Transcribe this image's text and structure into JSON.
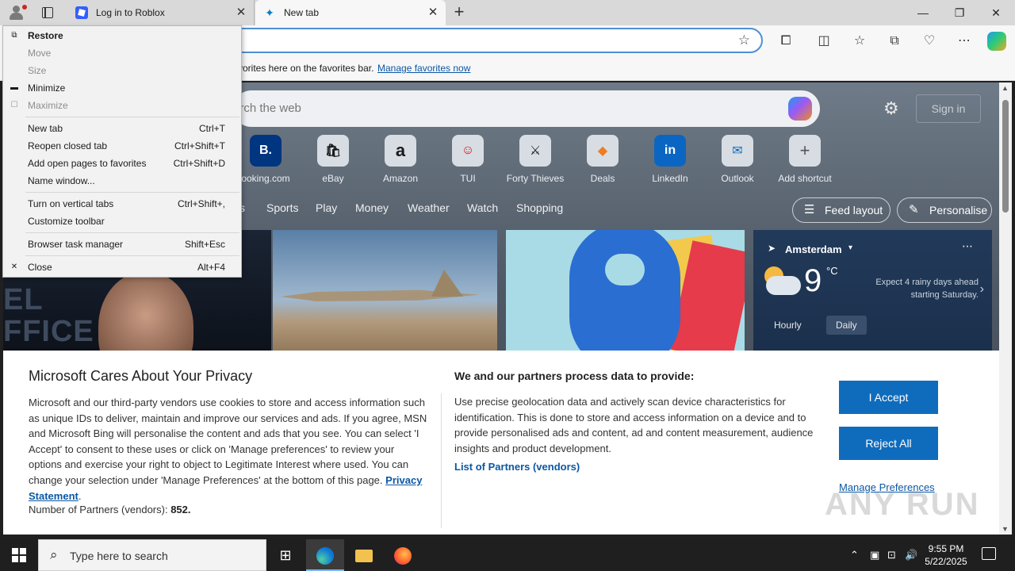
{
  "tabs": [
    {
      "title": "Log in to Roblox"
    },
    {
      "title": "New tab"
    }
  ],
  "window_controls": {
    "minimize": "—",
    "restore": "❐",
    "close": "✕"
  },
  "favorites_bar": {
    "text": "vorites here on the favorites bar.",
    "link": "Manage favorites now"
  },
  "newtab": {
    "search_placeholder": "arch the web",
    "sign_in": "Sign in",
    "shortcuts": [
      {
        "label": "ooking.com",
        "glyph": "B."
      },
      {
        "label": "eBay",
        "glyph": "🛍"
      },
      {
        "label": "Amazon",
        "glyph": "a"
      },
      {
        "label": "TUI",
        "glyph": "☺"
      },
      {
        "label": "Forty Thieves",
        "glyph": "⚔"
      },
      {
        "label": "Deals",
        "glyph": "◆"
      },
      {
        "label": "LinkedIn",
        "glyph": "in"
      },
      {
        "label": "Outlook",
        "glyph": "✉"
      },
      {
        "label": "Add shortcut",
        "glyph": "+"
      }
    ],
    "nav": [
      "s",
      "Sports",
      "Play",
      "Money",
      "Weather",
      "Watch",
      "Shopping"
    ],
    "feed_layout": "Feed layout",
    "personalise": "Personalise",
    "card1_text": "EL\nFFICE",
    "weather": {
      "location": "Amsterdam",
      "temp": "9",
      "unit": "°C",
      "forecast": "Expect 4 rainy days ahead starting Saturday.",
      "tabs": [
        "Hourly",
        "Daily"
      ],
      "active_tab": "Daily"
    }
  },
  "privacy": {
    "title": "Microsoft Cares About Your Privacy",
    "body": "Microsoft and our third-party vendors use cookies to store and access information such as unique IDs to deliver, maintain and improve our services and ads. If you agree, MSN and Microsoft Bing will personalise the content and ads that you see. You can select 'I Accept' to consent to these uses or click on 'Manage preferences' to review your options and exercise your right to object to Legitimate Interest where used.  You can change your selection under 'Manage Preferences' at the bottom of this page.",
    "privacy_link": "Privacy Statement",
    "partners_label": "Number of Partners (vendors):",
    "partners_count": "852.",
    "heading2": "We and our partners process data to provide:",
    "body2": "Use precise geolocation data and actively scan device characteristics for identification. This is done to store and access information on a device and to provide personalised ads and content, ad and content measurement, audience insights and product development.",
    "vendors_link": "List of Partners (vendors)",
    "accept": "I Accept",
    "reject": "Reject All",
    "manage": "Manage Preferences"
  },
  "watermark": "ANY RUN",
  "menu": {
    "items": [
      {
        "label": "Restore",
        "key": "",
        "icon": "restore-icon",
        "glyph": "⧉",
        "disabled": false,
        "bold": true
      },
      {
        "label": "Move",
        "key": "",
        "icon": "",
        "glyph": "",
        "disabled": true,
        "bold": false
      },
      {
        "label": "Size",
        "key": "",
        "icon": "",
        "glyph": "",
        "disabled": true,
        "bold": false
      },
      {
        "label": "Minimize",
        "key": "",
        "icon": "minimize-icon",
        "glyph": "▬",
        "disabled": false,
        "bold": false
      },
      {
        "label": "Maximize",
        "key": "",
        "icon": "maximize-icon",
        "glyph": "☐",
        "disabled": true,
        "bold": false
      },
      {
        "label": "New tab",
        "key": "Ctrl+T",
        "icon": "",
        "glyph": "",
        "disabled": false,
        "bold": false
      },
      {
        "label": "Reopen closed tab",
        "key": "Ctrl+Shift+T",
        "icon": "",
        "glyph": "",
        "disabled": false,
        "bold": false
      },
      {
        "label": "Add open pages to favorites",
        "key": "Ctrl+Shift+D",
        "icon": "",
        "glyph": "",
        "disabled": false,
        "bold": false
      },
      {
        "label": "Name window...",
        "key": "",
        "icon": "",
        "glyph": "",
        "disabled": false,
        "bold": false
      },
      {
        "label": "Turn on vertical tabs",
        "key": "Ctrl+Shift+,",
        "icon": "",
        "glyph": "",
        "disabled": false,
        "bold": false
      },
      {
        "label": "Customize toolbar",
        "key": "",
        "icon": "",
        "glyph": "",
        "disabled": false,
        "bold": false
      },
      {
        "label": "Browser task manager",
        "key": "Shift+Esc",
        "icon": "",
        "glyph": "",
        "disabled": false,
        "bold": false
      },
      {
        "label": "Close",
        "key": "Alt+F4",
        "icon": "close-icon",
        "glyph": "✕",
        "disabled": false,
        "bold": false
      }
    ]
  },
  "taskbar": {
    "search_placeholder": "Type here to search",
    "time": "9:55 PM",
    "date": "5/22/2025"
  }
}
